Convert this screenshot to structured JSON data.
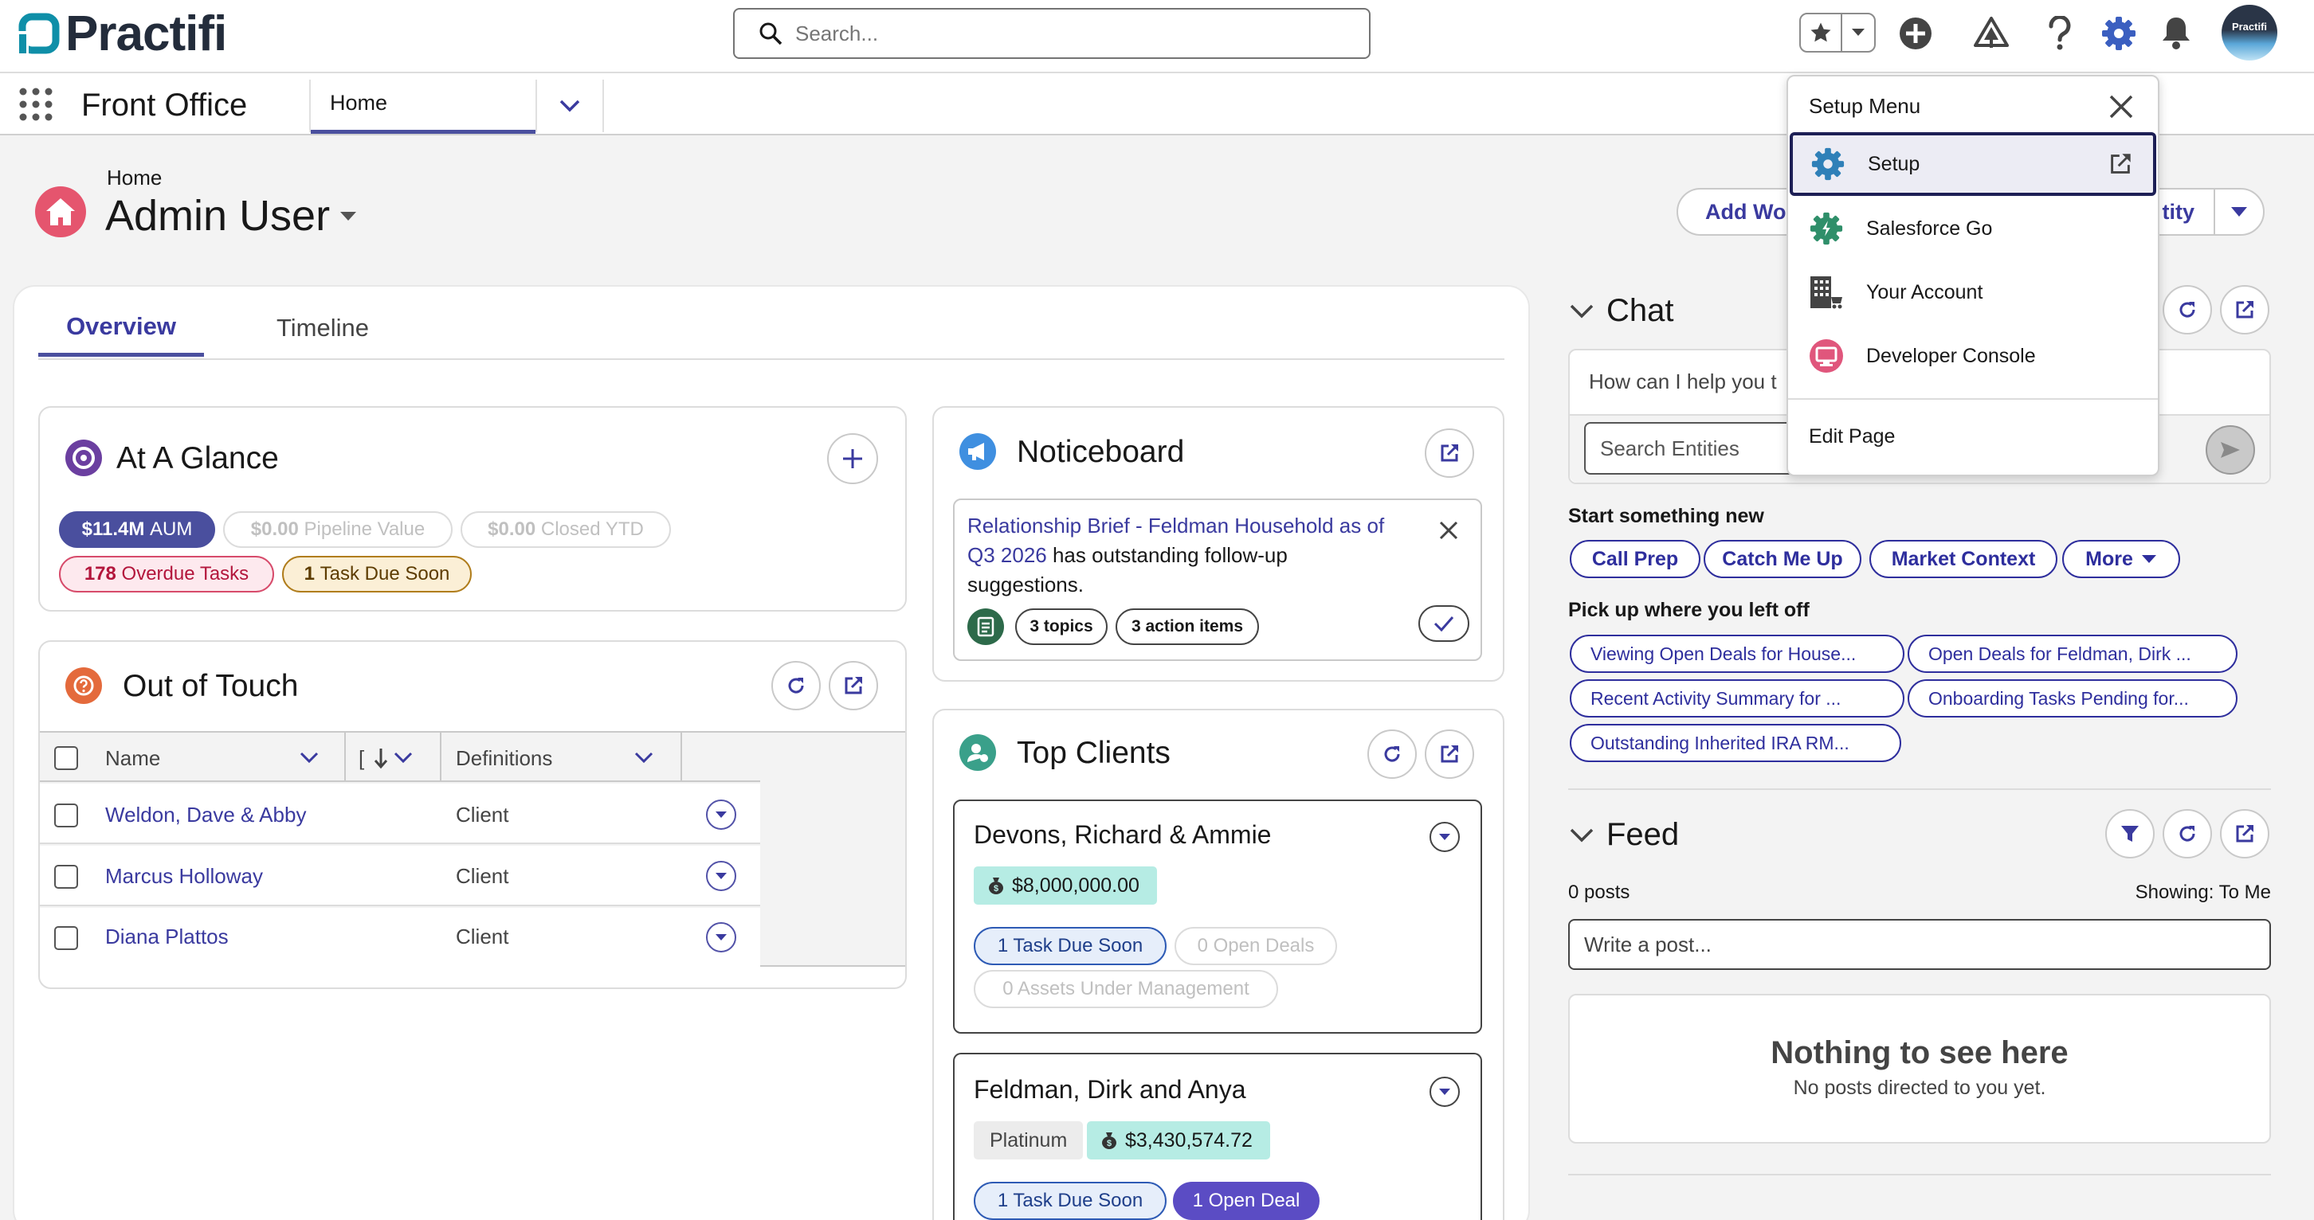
{
  "brand": {
    "name": "Practifi",
    "avatar_text": "Practifi"
  },
  "search": {
    "placeholder": "Search..."
  },
  "app": {
    "name": "Front Office",
    "tab": "Home"
  },
  "page": {
    "breadcrumb": "Home",
    "title": "Admin User"
  },
  "header_buttons": {
    "add_work": "Add Wor",
    "entity": "tity"
  },
  "tabs": {
    "overview": "Overview",
    "timeline": "Timeline"
  },
  "glance": {
    "title": "At A Glance",
    "pills": [
      {
        "value": "$11.4M",
        "label": "AUM"
      },
      {
        "value": "$0.00",
        "label": "Pipeline Value"
      },
      {
        "value": "$0.00",
        "label": "Closed YTD"
      },
      {
        "value": "178",
        "label": "Overdue Tasks"
      },
      {
        "value": "1",
        "label": "Task Due Soon"
      }
    ]
  },
  "out_of_touch": {
    "title": "Out of Touch",
    "columns": [
      "Name",
      "[",
      "Definitions"
    ],
    "rows": [
      {
        "name": "Weldon, Dave & Abby",
        "definition": "Client"
      },
      {
        "name": "Marcus Holloway",
        "definition": "Client"
      },
      {
        "name": "Diana Plattos",
        "definition": "Client"
      }
    ]
  },
  "noticeboard": {
    "title": "Noticeboard",
    "notice": {
      "link": "Relationship Brief - Feldman Household as of Q3 2026",
      "text": " has outstanding follow-up suggestions.",
      "topics": "3 topics",
      "actions": "3 action items"
    }
  },
  "top_clients": {
    "title": "Top Clients",
    "clients": [
      {
        "name": "Devons, Richard & Ammie",
        "aum": "$8,000,000.00",
        "tasks": "1 Task Due Soon",
        "deals": "0 Open Deals",
        "assets": "0 Assets Under Management"
      },
      {
        "name": "Feldman, Dirk and Anya",
        "tier": "Platinum",
        "aum": "$3,430,574.72",
        "tasks": "1 Task Due Soon",
        "deals": "1 Open Deal"
      }
    ]
  },
  "chat": {
    "title": "Chat",
    "prompt": "How can I help you t",
    "search_placeholder": "Search Entities",
    "start_label": "Start something new",
    "start_chips": [
      "Call Prep",
      "Catch Me Up",
      "Market Context",
      "More"
    ],
    "pickup_label": "Pick up where you left off",
    "pickup_chips": [
      "Viewing Open Deals for House...",
      "Open Deals for Feldman, Dirk ...",
      "Recent Activity Summary for ...",
      "Onboarding Tasks Pending for...",
      "Outstanding Inherited IRA RM..."
    ]
  },
  "feed": {
    "title": "Feed",
    "posts": "0 posts",
    "showing": "Showing: To Me",
    "write_placeholder": "Write a post...",
    "empty_title": "Nothing to see here",
    "empty_sub": "No posts directed to you yet."
  },
  "setup_menu": {
    "title": "Setup Menu",
    "items": [
      "Setup",
      "Salesforce Go",
      "Your Account",
      "Developer Console"
    ],
    "edit": "Edit Page"
  },
  "colors": {
    "brand": "#0f8fa8",
    "accent": "#2e2e9d",
    "active_tab": "#4a4f9e",
    "gear": "#3b5fc0"
  }
}
